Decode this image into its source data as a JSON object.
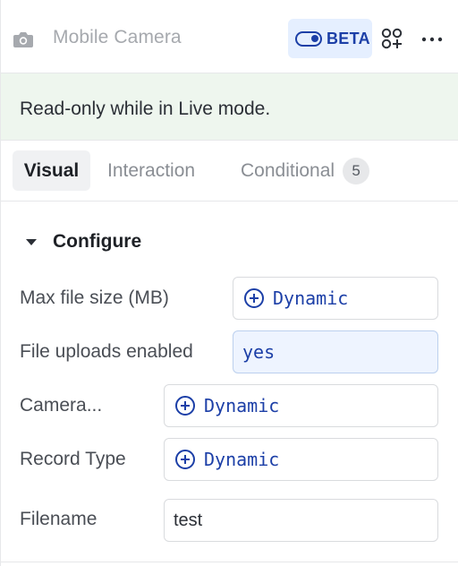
{
  "header": {
    "title": "Mobile Camera",
    "camera_icon": "camera-icon",
    "beta_label": "BETA",
    "apps_icon": "add-component-icon",
    "more_icon": "more-horizontal-icon"
  },
  "banner": {
    "text": "Read-only while in Live mode."
  },
  "tabs": [
    {
      "label": "Visual",
      "active": true
    },
    {
      "label": "Interaction",
      "active": false
    },
    {
      "label": "Conditional",
      "active": false,
      "count": "5"
    }
  ],
  "section": {
    "title": "Configure",
    "expanded": true
  },
  "fields": [
    {
      "label": "Max file size (MB)",
      "value": "Dynamic",
      "kind": "dynamic"
    },
    {
      "label": "File uploads enabled",
      "value": "yes",
      "kind": "filled"
    },
    {
      "label": "Camera...",
      "value": "Dynamic",
      "kind": "dynamic"
    },
    {
      "label": "Record Type",
      "value": "Dynamic",
      "kind": "dynamic"
    },
    {
      "label": "Filename",
      "value": "test",
      "kind": "text"
    }
  ],
  "colors": {
    "accent": "#1c3fa7",
    "banner_bg": "#eef6ee",
    "beta_bg": "#e5efff"
  }
}
